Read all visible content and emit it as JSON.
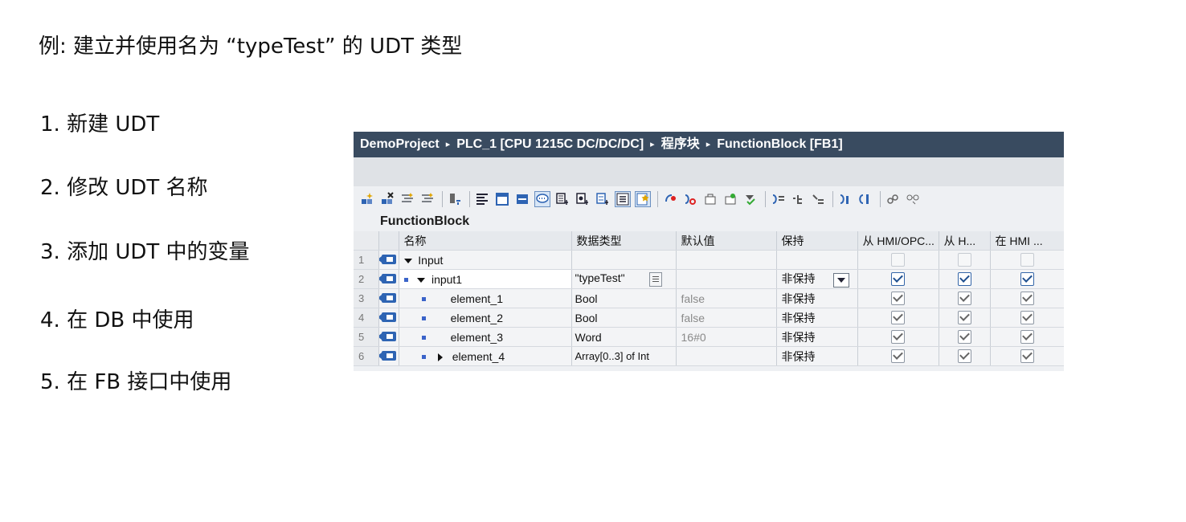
{
  "slide": {
    "title": "例: 建立并使用名为 “typeTest” 的 UDT 类型",
    "steps": [
      "1. 新建 UDT",
      "2. 修改 UDT 名称",
      "3. 添加 UDT 中的变量",
      "4. 在 DB 中使用",
      "5. 在 FB 接口中使用"
    ]
  },
  "editor": {
    "breadcrumb": [
      "DemoProject",
      "PLC_1 [CPU 1215C DC/DC/DC]",
      "程序块",
      "FunctionBlock [FB1]"
    ],
    "breadcrumb_separator": "▸",
    "block_name": "FunctionBlock",
    "toolbar_icons": [
      "insert-row-icon",
      "delete-row-icon",
      "indent-icon",
      "outdent-icon",
      "monitor-icon",
      "align-left-icon",
      "window-icon",
      "window-blue-icon",
      "comment-icon",
      "expand-icon",
      "expand2-icon",
      "expand3-icon",
      "list-icon",
      "star-icon",
      "reset-icon",
      "snapshot-icon",
      "load-icon",
      "load-start-icon",
      "apply-icon",
      "copy-start-icon",
      "edit-icon",
      "edit2-icon",
      "value-icon",
      "value2-icon",
      "glasses-icon",
      "more-icon"
    ],
    "columns": [
      "名称",
      "数据类型",
      "默认值",
      "保持",
      "从 HMI/OPC...",
      "从 H...",
      "在 HMI ..."
    ],
    "rows": [
      {
        "num": "1",
        "name": "Input",
        "type": "",
        "default": "",
        "retain": "",
        "hmi1": "off",
        "hmi2": "off",
        "hmi3": "off"
      },
      {
        "num": "2",
        "name": "input1",
        "type": "\"typeTest\"",
        "default": "",
        "retain": "非保持",
        "hmi1": "blue",
        "hmi2": "blue",
        "hmi3": "blue"
      },
      {
        "num": "3",
        "name": "element_1",
        "type": "Bool",
        "default": "false",
        "retain": "非保持",
        "hmi1": "gray",
        "hmi2": "gray",
        "hmi3": "gray"
      },
      {
        "num": "4",
        "name": "element_2",
        "type": "Bool",
        "default": "false",
        "retain": "非保持",
        "hmi1": "gray",
        "hmi2": "gray",
        "hmi3": "gray"
      },
      {
        "num": "5",
        "name": "element_3",
        "type": "Word",
        "default": "16#0",
        "retain": "非保持",
        "hmi1": "gray",
        "hmi2": "gray",
        "hmi3": "gray"
      },
      {
        "num": "6",
        "name": "element_4",
        "type": "Array[0..3] of Int",
        "default": "",
        "retain": "非保持",
        "hmi1": "gray",
        "hmi2": "gray",
        "hmi3": "gray"
      }
    ]
  },
  "colors": {
    "breadcrumb_bg": "#394b60",
    "accent_blue": "#2e64b3"
  }
}
